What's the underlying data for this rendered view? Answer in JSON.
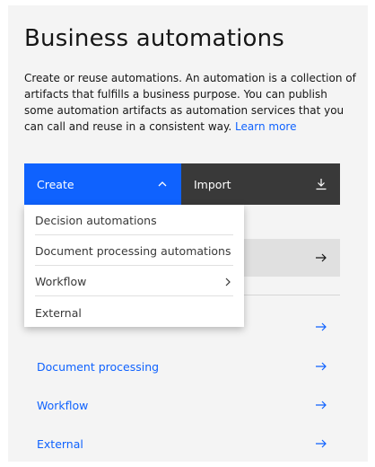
{
  "page": {
    "title": "Business automations",
    "description": "Create or reuse automations. An automation is a collection of artifacts that fulfills a business purpose. You can publish some automation artifacts as automation services that you can call and reuse in a consistent way.",
    "learn_more": "Learn more"
  },
  "actions": {
    "create_label": "Create",
    "import_label": "Import"
  },
  "create_menu": {
    "items": [
      {
        "label": "Decision automations"
      },
      {
        "label": "Document processing automations"
      },
      {
        "label": "Workflow"
      },
      {
        "label": "External"
      }
    ]
  },
  "automation_list": {
    "items": [
      {
        "label": "Document processing"
      },
      {
        "label": "Workflow"
      },
      {
        "label": "External"
      }
    ]
  },
  "colors": {
    "accent": "#0f62fe",
    "dark_button": "#393939",
    "panel_bg": "#f4f4f4"
  },
  "icons": {
    "create_chevron": "chevron-up-icon",
    "import": "download-icon",
    "submenu": "chevron-right-icon",
    "row": "arrow-right-icon"
  }
}
